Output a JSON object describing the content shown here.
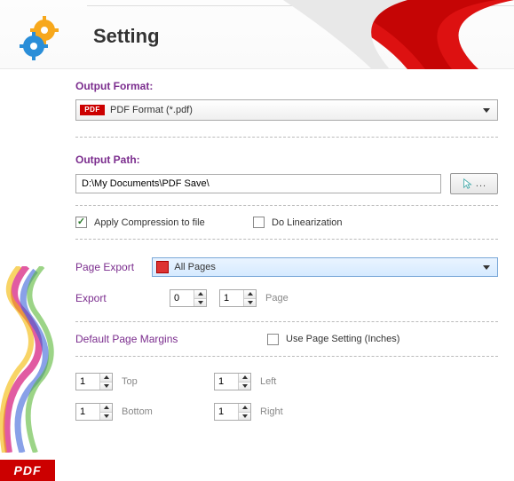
{
  "header": {
    "title": "Setting"
  },
  "outputFormat": {
    "label": "Output Format:",
    "badge": "PDF",
    "selected": "PDF Format (*.pdf)"
  },
  "outputPath": {
    "label": "Output Path:",
    "value": "D:\\My Documents\\PDF Save\\"
  },
  "options": {
    "applyCompression": {
      "label": "Apply Compression to file",
      "checked": true
    },
    "doLinearization": {
      "label": "Do Linearization",
      "checked": false
    }
  },
  "pageExport": {
    "label": "Page Export",
    "selected": "All Pages",
    "rangeLabel": "Export",
    "from": "0",
    "to": "1",
    "unit": "Page"
  },
  "margins": {
    "label": "Default Page Margins",
    "usePageSetting": {
      "label": "Use Page Setting (Inches)",
      "checked": false
    },
    "top": {
      "label": "Top",
      "value": "1"
    },
    "bottom": {
      "label": "Bottom",
      "value": "1"
    },
    "left": {
      "label": "Left",
      "value": "1"
    },
    "right": {
      "label": "Right",
      "value": "1"
    }
  },
  "footerTag": "PDF"
}
